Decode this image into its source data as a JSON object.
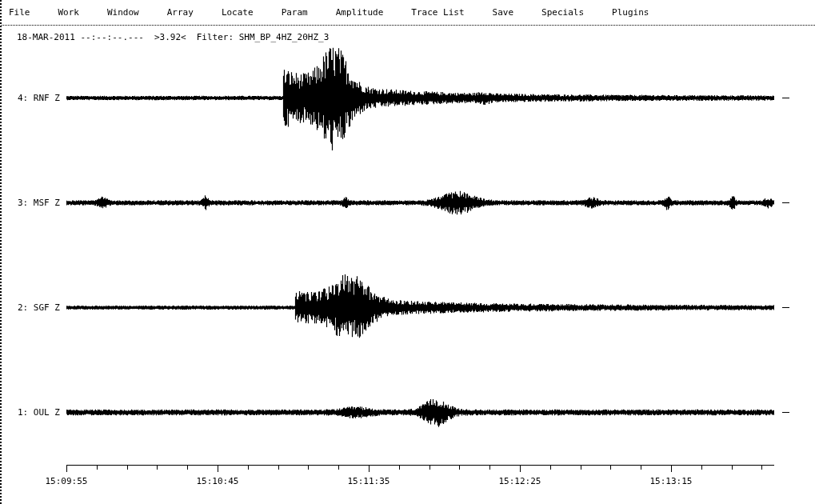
{
  "menu": [
    "File",
    "Work",
    "Window",
    "Array",
    "Locate",
    "Param",
    "Amplitude",
    "Trace List",
    "Save",
    "Specials",
    "Plugins"
  ],
  "header": {
    "date_time": "18-MAR-2011 --:--:--.---",
    "magnitude": ">3.92<",
    "filter": "Filter: SHM_BP_4HZ_20HZ_3"
  },
  "traces": [
    {
      "label": "4: RNF Z",
      "kind": "strong"
    },
    {
      "label": "3: MSF Z",
      "kind": "quiet"
    },
    {
      "label": "2: SGF Z",
      "kind": "medium"
    },
    {
      "label": "1: OUL Z",
      "kind": "weak"
    }
  ],
  "time_axis": {
    "labels": [
      "15:09:55",
      "15:10:45",
      "15:11:35",
      "15:12:25",
      "15:13:15"
    ]
  }
}
